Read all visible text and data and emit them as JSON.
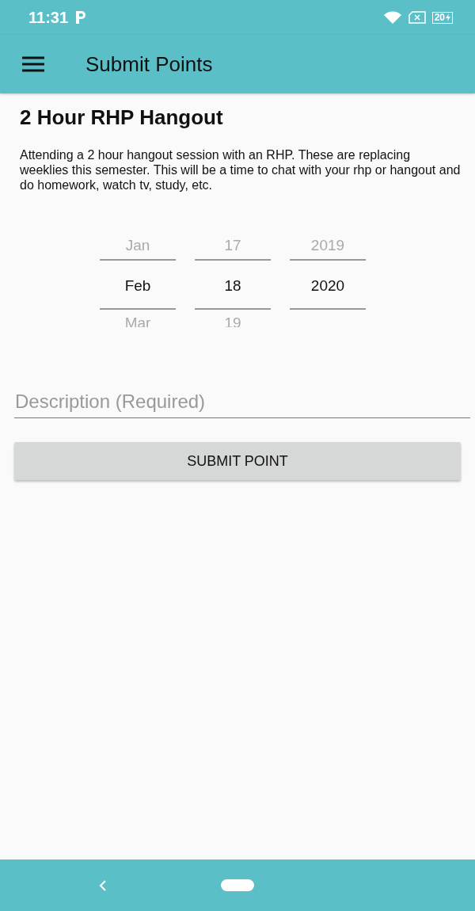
{
  "status_bar": {
    "time": "11:31",
    "battery": "20"
  },
  "app_bar": {
    "title": "Submit Points"
  },
  "event": {
    "title": "2 Hour RHP Hangout",
    "description": "Attending a 2 hour hangout session with an RHP. These are replacing weeklies this semester. This will be a time to chat with your rhp or hangout and do homework, watch tv, study, etc."
  },
  "date_picker": {
    "columns": [
      {
        "items": [
          {
            "label": "Jan",
            "selected": false
          },
          {
            "label": "Feb",
            "selected": true
          },
          {
            "label": "Mar",
            "selected": false
          }
        ]
      },
      {
        "items": [
          {
            "label": "17",
            "selected": false
          },
          {
            "label": "18",
            "selected": true
          },
          {
            "label": "19",
            "selected": false
          }
        ]
      },
      {
        "items": [
          {
            "label": "2019",
            "selected": false
          },
          {
            "label": "2020",
            "selected": true
          }
        ]
      }
    ]
  },
  "description_field": {
    "placeholder": "Description (Required)"
  },
  "submit_button": {
    "label": "SUBMIT POINT"
  }
}
